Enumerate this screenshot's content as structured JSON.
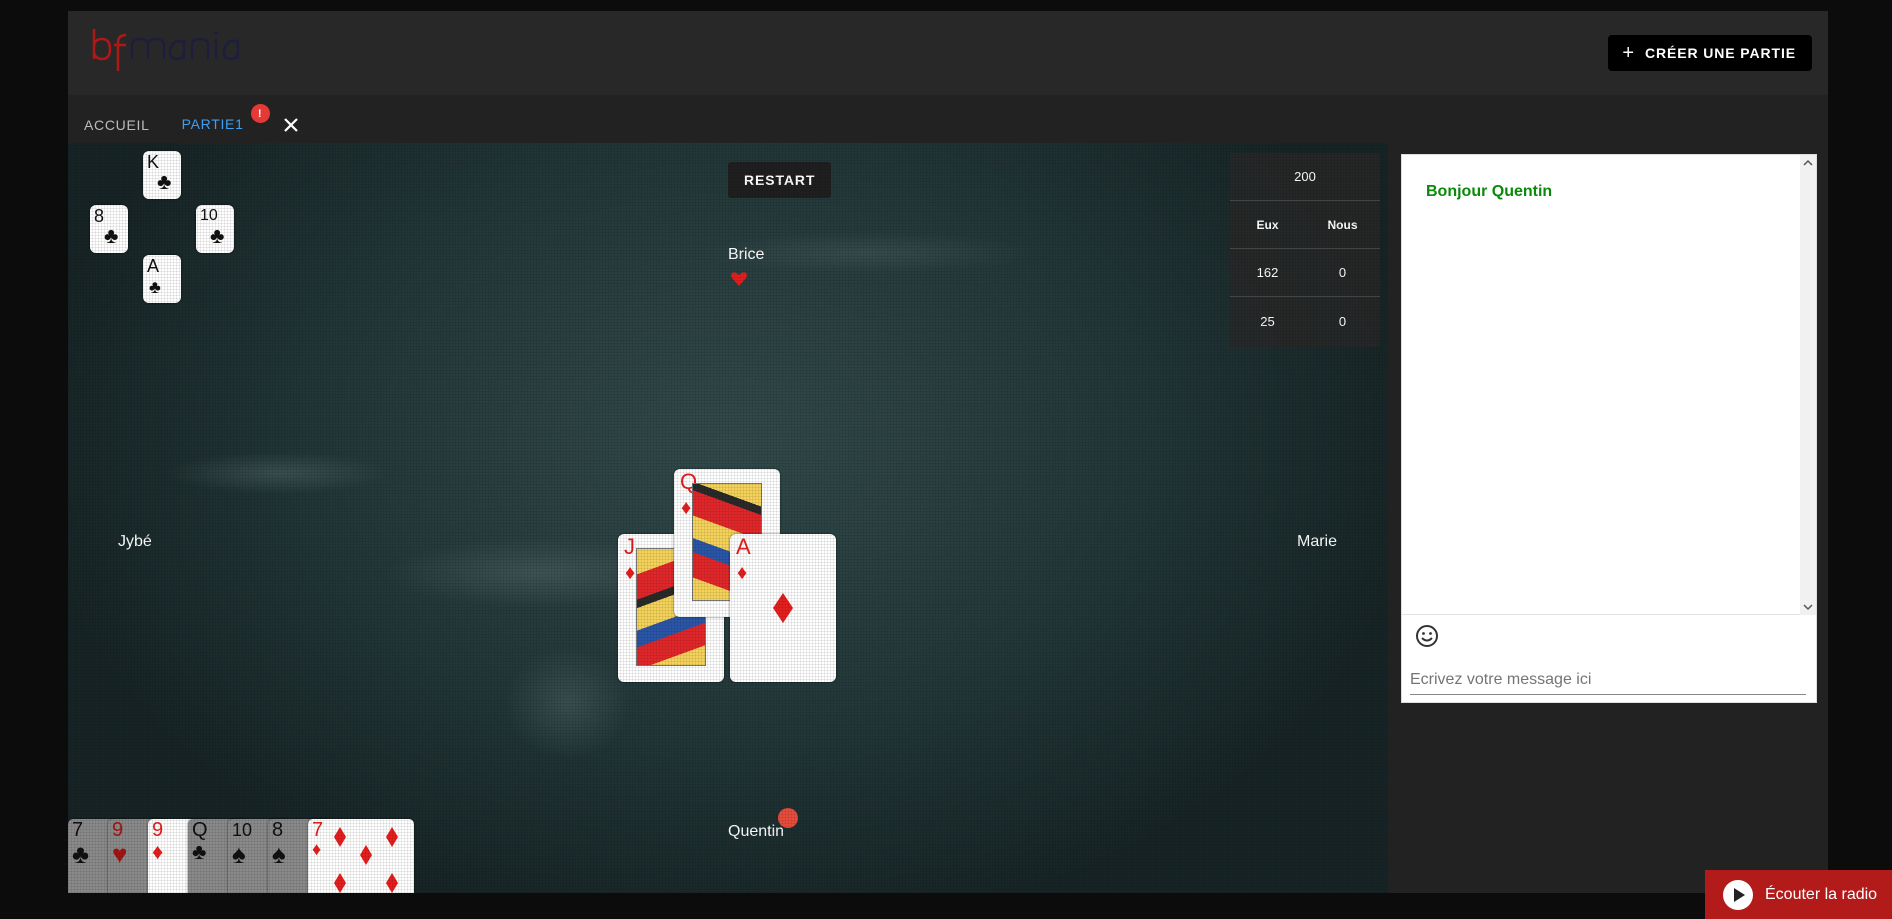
{
  "logo_text": "bfmania",
  "header": {
    "create_button": "CRÉER UNE PARTIE"
  },
  "tabs": [
    {
      "label": "ACCUEIL"
    },
    {
      "label": "PARTIE1",
      "badge": "!"
    }
  ],
  "game": {
    "restart_label": "RESTART",
    "players": {
      "top": "Brice",
      "left": "Jybé",
      "right": "Marie",
      "bottom": "Quentin"
    },
    "score": {
      "target": "200",
      "headers": [
        "Eux",
        "Nous"
      ],
      "rows": [
        [
          "162",
          "0"
        ],
        [
          "25",
          "0"
        ]
      ]
    },
    "last_trick": [
      {
        "rank": "K",
        "suit": "♣"
      },
      {
        "rank": "8",
        "suit": "♣"
      },
      {
        "rank": "10",
        "suit": "♣"
      },
      {
        "rank": "A",
        "suit": "♣"
      }
    ],
    "table_cards": [
      {
        "rank": "Q",
        "suit": "♦"
      },
      {
        "rank": "J",
        "suit": "♦"
      },
      {
        "rank": "A",
        "suit": "♦"
      }
    ],
    "hand": [
      {
        "rank": "7",
        "suit": "♣"
      },
      {
        "rank": "9",
        "suit": "♥"
      },
      {
        "rank": "9",
        "suit": "♦"
      },
      {
        "rank": "Q",
        "suit": "♣"
      },
      {
        "rank": "10",
        "suit": "♠"
      },
      {
        "rank": "8",
        "suit": "♠"
      },
      {
        "rank": "7",
        "suit": "♦"
      }
    ],
    "trump_color": "#e61e1e"
  },
  "chat": {
    "greeting": "Bonjour Quentin",
    "placeholder": "Ecrivez votre message ici"
  },
  "radio": {
    "label": "Écouter la radio"
  }
}
